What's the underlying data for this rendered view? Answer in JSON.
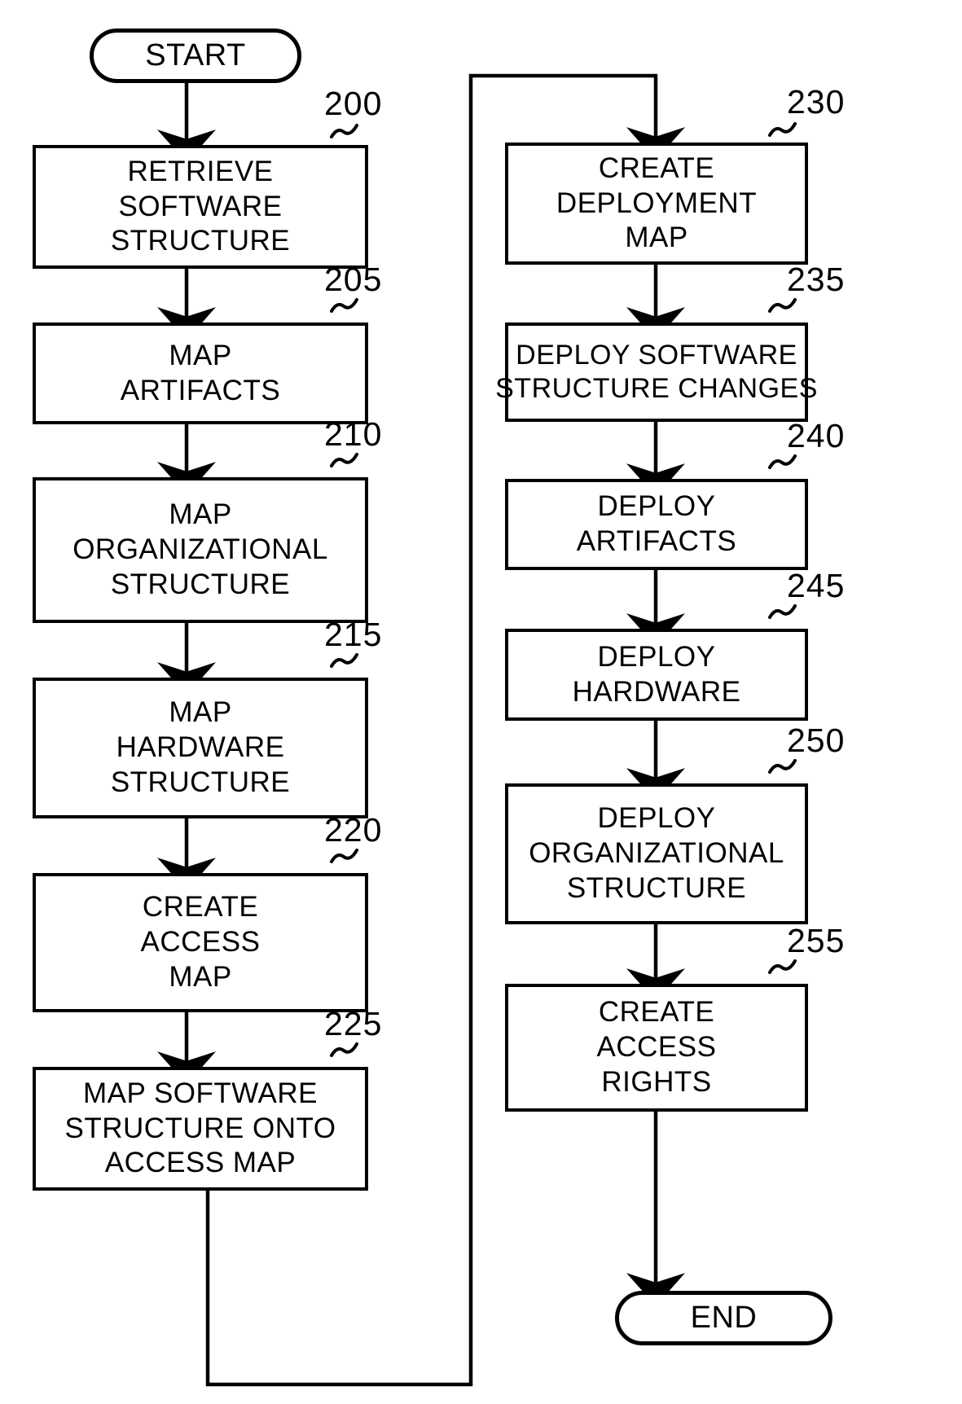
{
  "diagram": {
    "type": "flowchart",
    "title": "",
    "terminators": {
      "start": "START",
      "end": "END"
    },
    "nodes": [
      {
        "ref": "200",
        "lines": [
          "RETRIEVE",
          "SOFTWARE",
          "STRUCTURE"
        ]
      },
      {
        "ref": "205",
        "lines": [
          "MAP",
          "ARTIFACTS"
        ]
      },
      {
        "ref": "210",
        "lines": [
          "MAP",
          "ORGANIZATIONAL",
          "STRUCTURE"
        ]
      },
      {
        "ref": "215",
        "lines": [
          "MAP",
          "HARDWARE",
          "STRUCTURE"
        ]
      },
      {
        "ref": "220",
        "lines": [
          "CREATE",
          "ACCESS",
          "MAP"
        ]
      },
      {
        "ref": "225",
        "lines": [
          "MAP SOFTWARE",
          "STRUCTURE ONTO",
          "ACCESS MAP"
        ]
      },
      {
        "ref": "230",
        "lines": [
          "CREATE",
          "DEPLOYMENT",
          "MAP"
        ]
      },
      {
        "ref": "235",
        "lines": [
          "DEPLOY SOFTWARE",
          "STRUCTURE CHANGES"
        ]
      },
      {
        "ref": "240",
        "lines": [
          "DEPLOY",
          "ARTIFACTS"
        ]
      },
      {
        "ref": "245",
        "lines": [
          "DEPLOY",
          "HARDWARE"
        ]
      },
      {
        "ref": "250",
        "lines": [
          "DEPLOY",
          "ORGANIZATIONAL",
          "STRUCTURE"
        ]
      },
      {
        "ref": "255",
        "lines": [
          "CREATE",
          "ACCESS",
          "RIGHTS"
        ]
      }
    ],
    "colors": {
      "stroke": "#000000",
      "fill": "#ffffff"
    }
  }
}
